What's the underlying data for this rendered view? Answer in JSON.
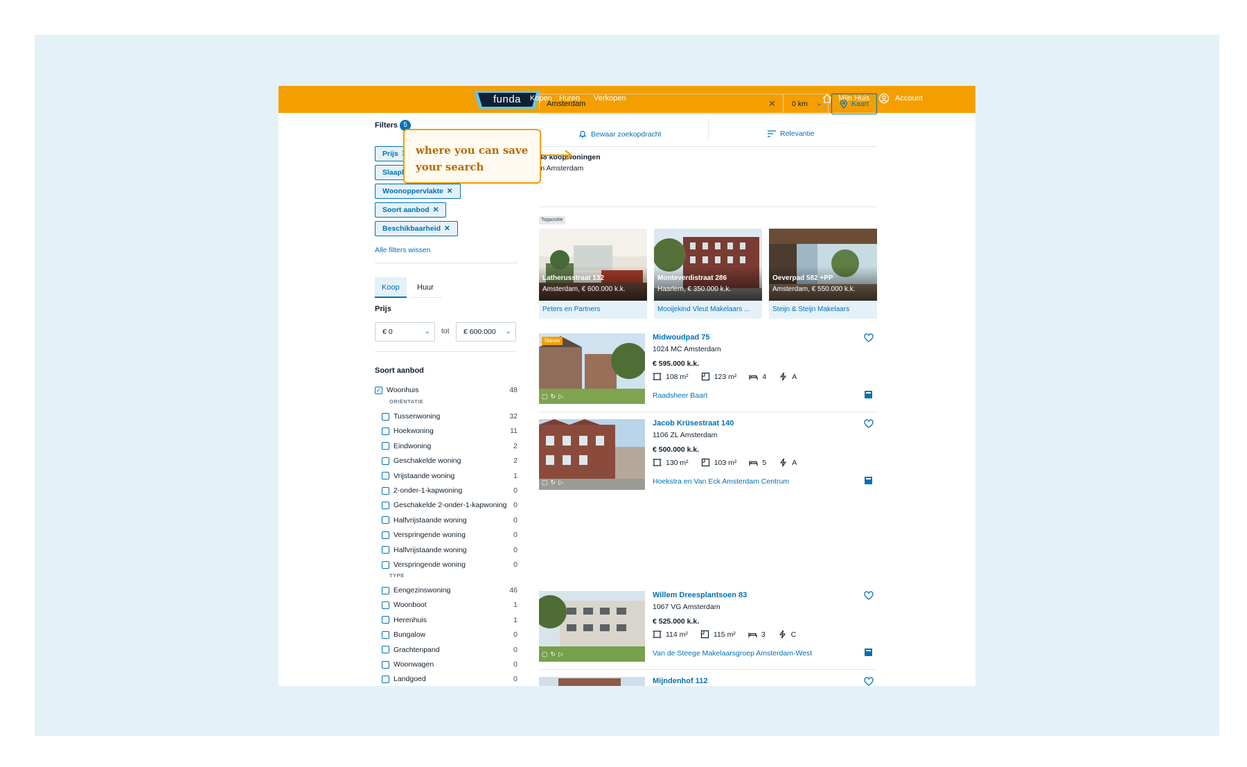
{
  "header": {
    "logo_text": "funda",
    "nav": [
      "Kopen",
      "Huren",
      "Verkopen"
    ],
    "mijn_huis": "Mijn Huis",
    "account": "Account"
  },
  "filters": {
    "title": "Filters",
    "count": "5",
    "chips": [
      "Prijs",
      "Slaapk",
      "Woonoppervlakte",
      "Soort aanbod",
      "Beschikbaarheid"
    ],
    "clear_all": "Alle filters wissen"
  },
  "tabs": [
    "Koop",
    "Huur"
  ],
  "price": {
    "label": "Prijs",
    "min": "€ 0",
    "to": "tot",
    "max": "€ 600.000"
  },
  "soort_aanbod": {
    "title": "Soort aanbod",
    "main": {
      "label": "Woonhuis",
      "count": "48"
    },
    "orientatie_label": "ORIËNTATIE",
    "orientatie": [
      {
        "label": "Tussenwoning",
        "count": "32"
      },
      {
        "label": "Hoekwoning",
        "count": "11"
      },
      {
        "label": "Eindwoning",
        "count": "2"
      },
      {
        "label": "Geschakelde woning",
        "count": "2"
      },
      {
        "label": "Vrijstaande woning",
        "count": "1"
      },
      {
        "label": "2-onder-1-kapwoning",
        "count": "0"
      },
      {
        "label": "Geschakelde 2-onder-1-kapwoning",
        "count": "0"
      },
      {
        "label": "Halfvrijstaande woning",
        "count": "0"
      },
      {
        "label": "Verspringende woning",
        "count": "0"
      },
      {
        "label": "Halfvrijstaande woning",
        "count": "0"
      },
      {
        "label": "Verspringende woning",
        "count": "0"
      }
    ],
    "type_label": "TYPE",
    "type": [
      {
        "label": "Eengezinswoning",
        "count": "46"
      },
      {
        "label": "Woonboot",
        "count": "1"
      },
      {
        "label": "Herenhuis",
        "count": "1"
      },
      {
        "label": "Bungalow",
        "count": "0"
      },
      {
        "label": "Grachtenpand",
        "count": "0"
      },
      {
        "label": "Woonwagen",
        "count": "0"
      },
      {
        "label": "Landgoed",
        "count": "0"
      }
    ]
  },
  "search": {
    "value": "Amsterdam",
    "distance": "0 km",
    "map_button": "Kaart",
    "save_search": "Bewaar zoekopdracht",
    "sort": "Relevantie"
  },
  "results": {
    "count": "48 koopwoningen",
    "location": "in Amsterdam",
    "toppositie_label": "Toppositie"
  },
  "top_listings": [
    {
      "title": "Latherusstraat 132",
      "subtitle": "Amsterdam, € 600.000 k.k.",
      "agent": "Peters en Partners"
    },
    {
      "title": "Monteverdistraat 286",
      "subtitle": "Haarlem, € 350.000 k.k.",
      "agent": "Mooijekind Vleut Makelaars ..."
    },
    {
      "title": "Oeverpad 582 +PP",
      "subtitle": "Amsterdam, € 550.000 k.k.",
      "agent": "Steijn & Steijn Makelaars"
    }
  ],
  "listings": [
    {
      "title": "Midwoudpad 75",
      "zip": "1024 MC Amsterdam",
      "price": "€ 595.000 k.k.",
      "plot": "108 m²",
      "living": "123 m²",
      "rooms": "4",
      "energy": "A",
      "agent": "Raadsheer Baart",
      "badge": "Nieuw"
    },
    {
      "title": "Jacob Krüsestraat 140",
      "zip": "1106 ZL Amsterdam",
      "price": "€ 500.000 k.k.",
      "plot": "130 m²",
      "living": "103 m²",
      "rooms": "5",
      "energy": "A",
      "agent": "Hoekstra en Van Eck Amsterdam Centrum"
    },
    {
      "title": "Willem Dreesplantsoen 83",
      "zip": "1067 VG Amsterdam",
      "price": "€ 525.000 k.k.",
      "plot": "114 m²",
      "living": "115 m²",
      "rooms": "3",
      "energy": "C",
      "agent": "Van de Steege Makelaarsgroep Amsterdam-West"
    },
    {
      "title": "Mijndenhof 112"
    }
  ],
  "callout": {
    "line1": "where you can save",
    "line2": "your search"
  },
  "colors": {
    "brand_orange": "#f59e00",
    "link_blue": "#0071b3",
    "page_bg": "#e5f1f8"
  }
}
